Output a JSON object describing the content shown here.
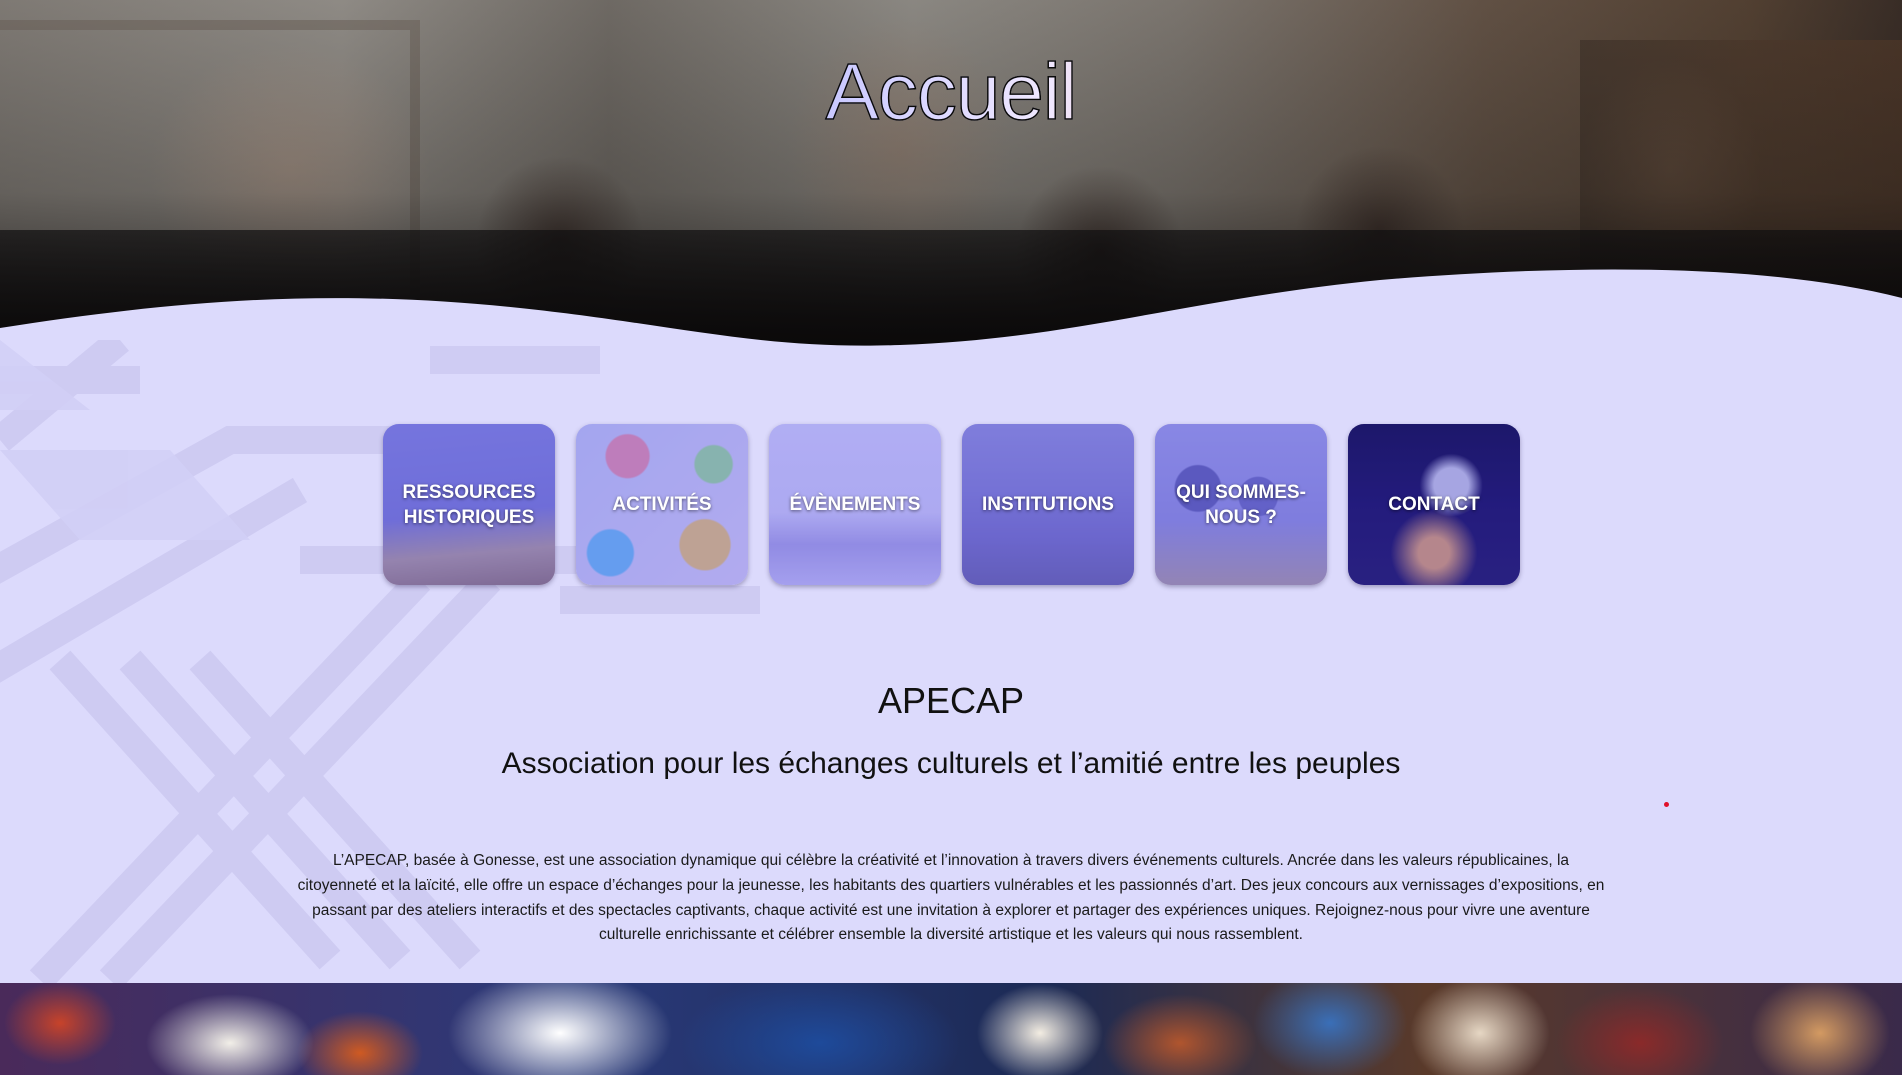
{
  "hero": {
    "title": "Accueil"
  },
  "nav": {
    "cards": [
      {
        "label": "Ressources historiques",
        "icon": "equestrian-statue-photo"
      },
      {
        "label": "Activités",
        "icon": "craft-activities-photo"
      },
      {
        "label": "Évènements",
        "icon": "crowd-celebration-photo"
      },
      {
        "label": "Institutions",
        "icon": "government-building-photo"
      },
      {
        "label": "Qui sommes-nous ?",
        "icon": "team-meeting-photo"
      },
      {
        "label": "Contact",
        "icon": "envelope-hand-photo"
      }
    ]
  },
  "about": {
    "name": "APECAP",
    "tagline": "Association pour les échanges culturels et l’amitié entre les peuples",
    "description": "L’APECAP, basée à Gonesse, est une association dynamique qui célèbre la créativité et l’innovation à travers divers événements culturels. Ancrée dans les valeurs républicaines, la citoyenneté et la laïcité, elle offre un espace d’échanges pour la jeunesse, les habitants des quartiers vulnérables et les passionnés d’art. Des jeux concours aux vernissages d’expositions, en passant par des ateliers interactifs et des spectacles captivants, chaque activité est une invitation à explorer et partager des expériences uniques. Rejoignez-nous pour vivre une aventure culturelle enrichissante et célébrer ensemble la diversité artistique et les valeurs qui nous rassemblent."
  },
  "colors": {
    "page_background": "#dcdafc",
    "accent_dot": "#e0102a",
    "title_gradient": [
      "#5060ff",
      "#f0e8ff",
      "#c01818"
    ]
  }
}
